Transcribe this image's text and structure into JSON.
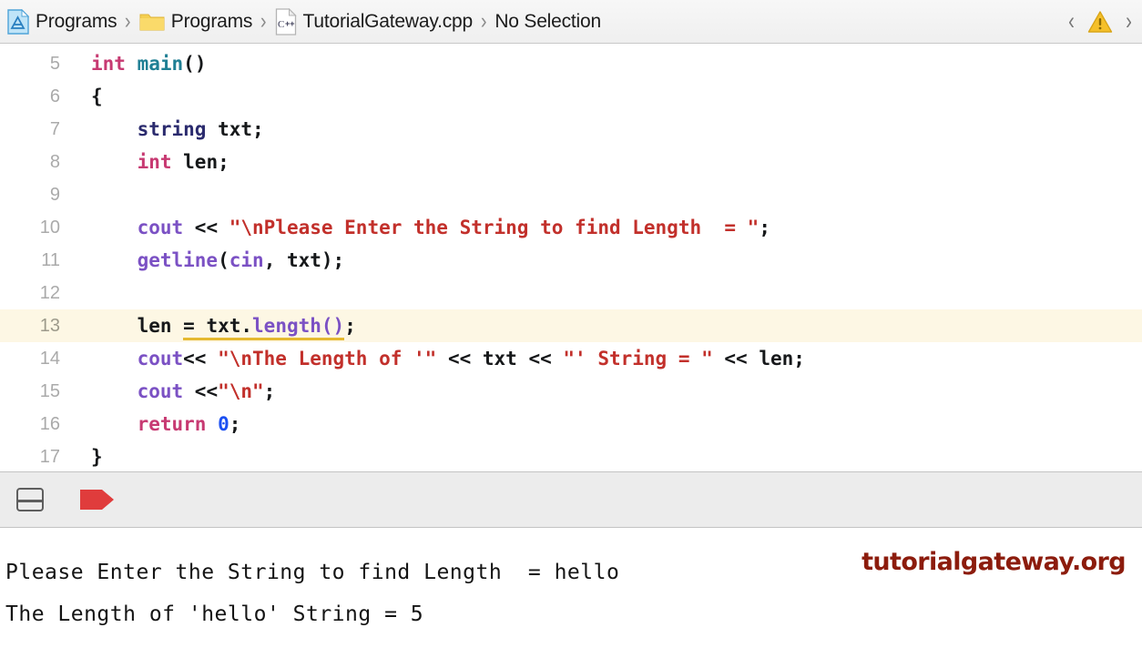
{
  "jumpbar": {
    "crumbs": [
      {
        "icon": "xcode-project-icon",
        "label": "Programs"
      },
      {
        "icon": "folder-icon",
        "label": "Programs"
      },
      {
        "icon": "cpp-file-icon",
        "label": "TutorialGateway.cpp"
      },
      {
        "icon": "none",
        "label": "No Selection"
      }
    ],
    "separator": "›",
    "back_chevron": "‹",
    "forward_chevron": "›",
    "warning_icon": "warning-triangle-icon",
    "warning_glyph": "!",
    "cpp_icon_text": "C++"
  },
  "editor": {
    "lines": [
      {
        "n": "5",
        "highlight": false
      },
      {
        "n": "6",
        "highlight": false
      },
      {
        "n": "7",
        "highlight": false
      },
      {
        "n": "8",
        "highlight": false
      },
      {
        "n": "9",
        "highlight": false
      },
      {
        "n": "10",
        "highlight": false
      },
      {
        "n": "11",
        "highlight": false
      },
      {
        "n": "12",
        "highlight": false
      },
      {
        "n": "13",
        "highlight": true
      },
      {
        "n": "14",
        "highlight": false
      },
      {
        "n": "15",
        "highlight": false
      },
      {
        "n": "16",
        "highlight": false
      },
      {
        "n": "17",
        "highlight": false
      }
    ],
    "code": {
      "l5": {
        "a": "int",
        "b": " ",
        "c": "main",
        "d": "()"
      },
      "l6": {
        "a": "{"
      },
      "l7": {
        "a": "    ",
        "b": "string",
        "c": " txt;"
      },
      "l8": {
        "a": "    ",
        "b": "int",
        "c": " len;"
      },
      "l9": {
        "a": ""
      },
      "l10": {
        "a": "    ",
        "b": "cout",
        "c": " << ",
        "d": "\"\\nPlease Enter the String to find Length  = \"",
        "e": ";"
      },
      "l11": {
        "a": "    ",
        "b": "getline",
        "c": "(",
        "d": "cin",
        "e": ", txt);"
      },
      "l12": {
        "a": ""
      },
      "l13": {
        "a": "    len ",
        "b": "=",
        "c": " txt.",
        "d": "length",
        "e": "()",
        "f": ";"
      },
      "l14": {
        "a": "    ",
        "b": "cout",
        "c": "<< ",
        "d": "\"\\nThe Length of '\"",
        "e": " << txt << ",
        "f": "\"' String = \"",
        "g": " << len;"
      },
      "l15": {
        "a": "    ",
        "b": "cout",
        "c": " <<",
        "d": "\"\\n\"",
        "e": ";"
      },
      "l16": {
        "a": "    ",
        "b": "return",
        "c": " ",
        "d": "0",
        "e": ";"
      },
      "l17": {
        "a": "}"
      }
    }
  },
  "toolbar": {
    "split_editor_icon": "split-pane-icon",
    "breakpoint_icon": "breakpoint-flag-icon"
  },
  "console": {
    "line1": "Please Enter the String to find Length  = hello",
    "line2": "The Length of 'hello' String = 5",
    "watermark": "tutorialgateway.org"
  },
  "colors": {
    "keyword": "#c73a72",
    "function": "#1f7f94",
    "type": "#2b2b6e",
    "object": "#7b51c4",
    "string": "#c2302b",
    "number": "#1b4ff2",
    "warning_underline": "#e5b930",
    "highlight_row": "#fdf7e4",
    "breakpoint_red": "#e03c3c",
    "watermark": "#8c1c0d"
  }
}
